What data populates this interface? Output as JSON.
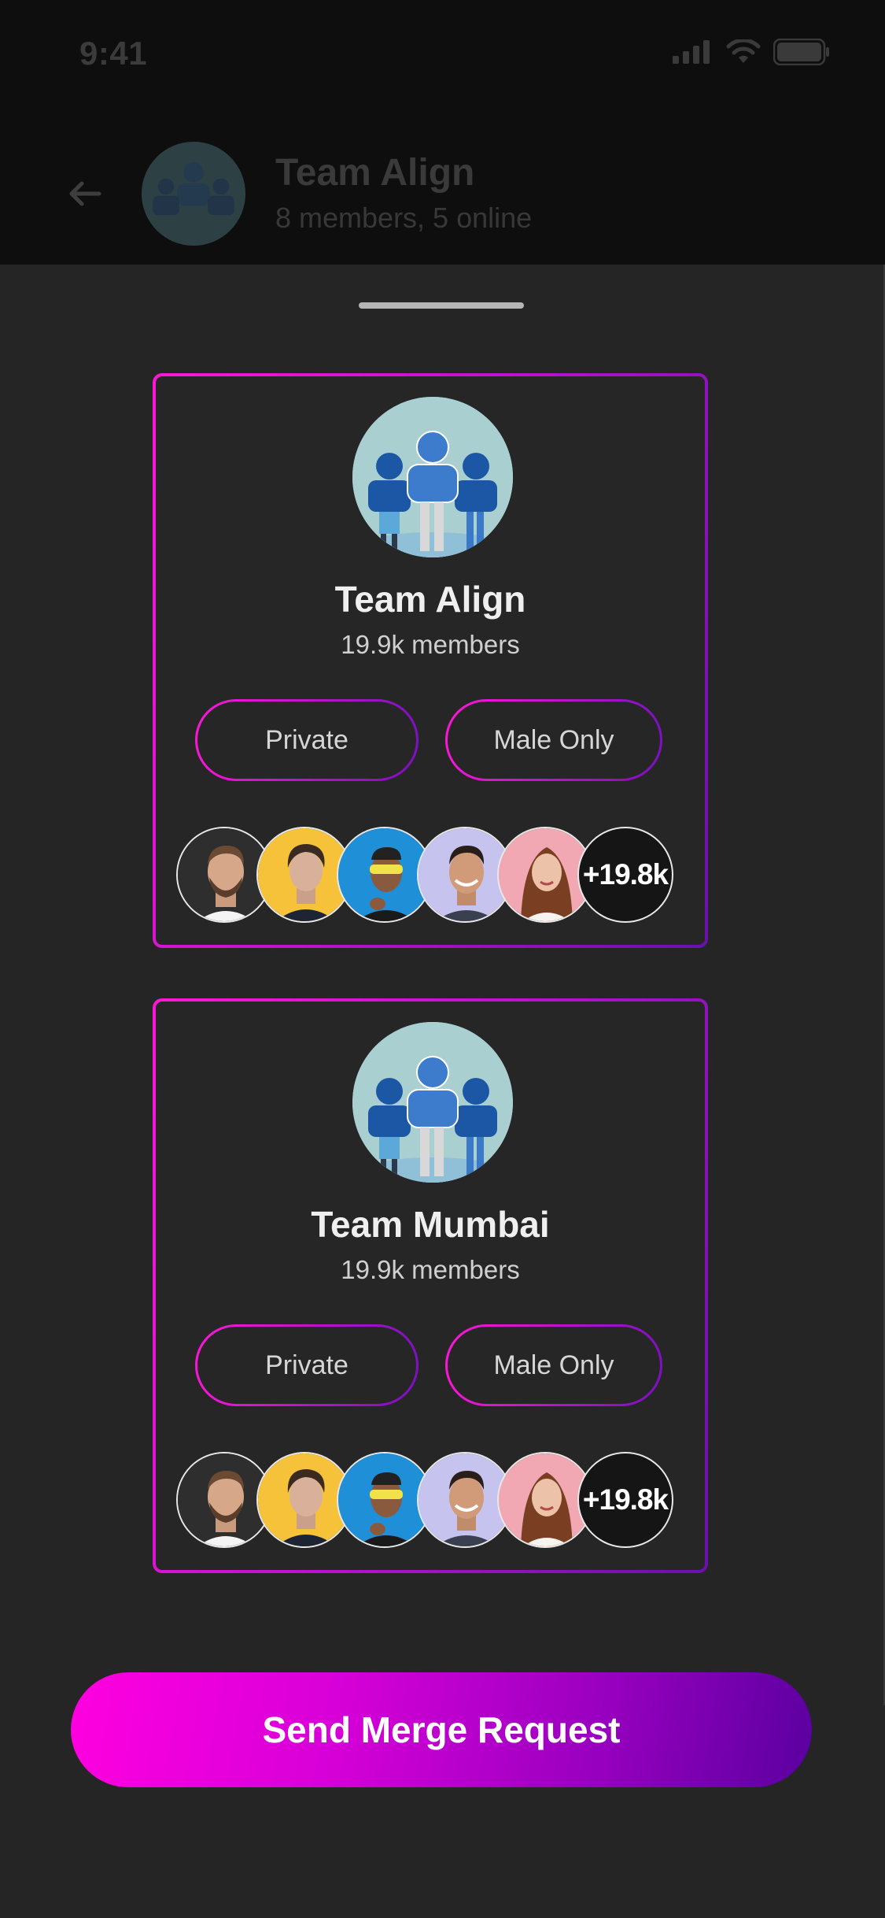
{
  "status_bar": {
    "time": "9:41",
    "icons": [
      "signal-icon",
      "wifi-icon",
      "battery-icon"
    ]
  },
  "header": {
    "title": "Team Align",
    "subtitle": "8 members, 5 online",
    "back_icon": "back-arrow-icon"
  },
  "groups": [
    {
      "name": "Team Align",
      "members": "19.9k members",
      "privacy": "Private",
      "gender": "Male Only",
      "more_count": "+19.8k"
    },
    {
      "name": "Team Mumbai",
      "members": "19.9k members",
      "privacy": "Private",
      "gender": "Male Only",
      "more_count": "+19.8k"
    }
  ],
  "cta": {
    "label": "Send Merge Request"
  },
  "colors": {
    "accent_start": "#ff00e0",
    "accent_end": "#5a00a0",
    "background": "#252525",
    "card_border": "#ff16d8"
  }
}
